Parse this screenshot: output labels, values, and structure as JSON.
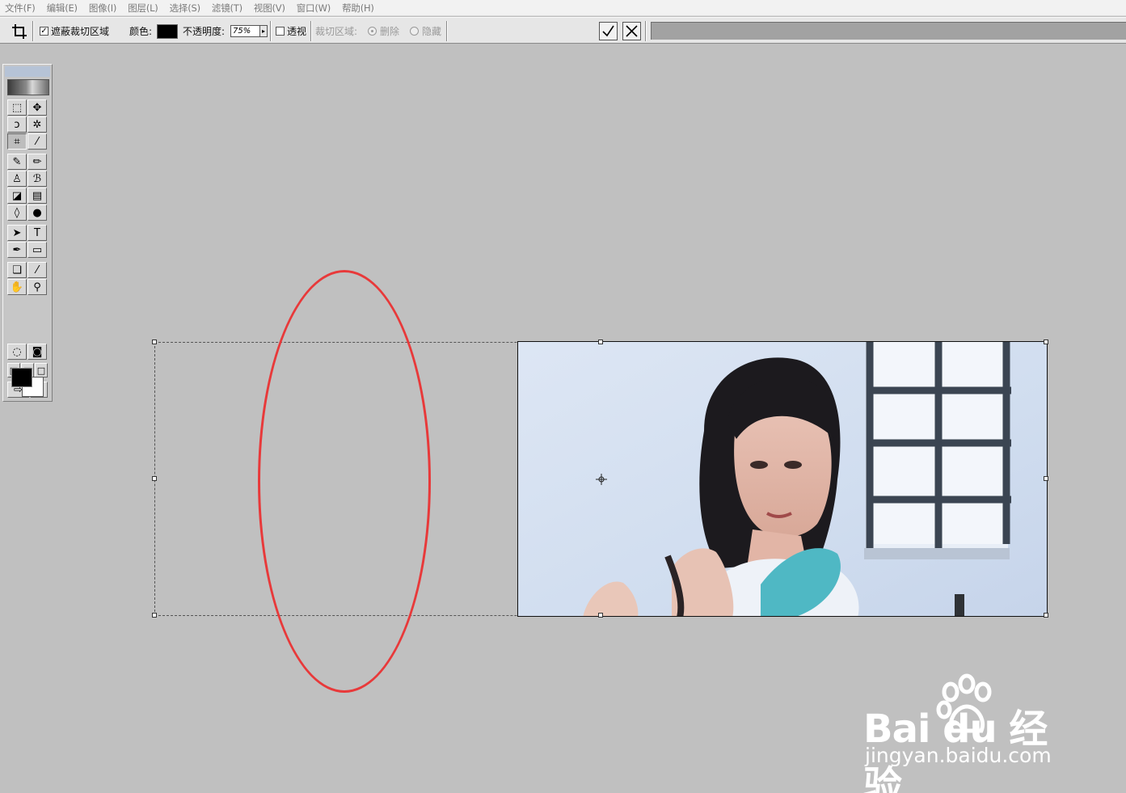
{
  "menu": [
    "文件(F)",
    "编辑(E)",
    "图像(I)",
    "图层(L)",
    "选择(S)",
    "滤镜(T)",
    "视图(V)",
    "窗口(W)",
    "帮助(H)"
  ],
  "options": {
    "shield_checkbox_label": "遮蔽裁切区域",
    "shield_checked": true,
    "color_label": "颜色:",
    "shield_color": "#000000",
    "opacity_label": "不透明度:",
    "opacity_value": "75%",
    "perspective_label": "透视",
    "perspective_checked": false,
    "crop_area_label": "裁切区域:",
    "delete_label": "删除",
    "hide_label": "隐藏",
    "delete_selected": true,
    "commit_icon": "checkmark-icon",
    "cancel_icon": "cancel-x-icon"
  },
  "toolbox": {
    "tools": [
      {
        "name": "marquee-tool",
        "glyph": "⬚"
      },
      {
        "name": "move-tool",
        "glyph": "✥"
      },
      {
        "name": "lasso-tool",
        "glyph": "ↄ"
      },
      {
        "name": "magic-wand-tool",
        "glyph": "✲"
      },
      {
        "name": "crop-tool",
        "glyph": "⌗"
      },
      {
        "name": "slice-tool",
        "glyph": "⁄"
      },
      {
        "name": "healing-brush-tool",
        "glyph": "✎"
      },
      {
        "name": "brush-tool",
        "glyph": "✏"
      },
      {
        "name": "clone-stamp-tool",
        "glyph": "♙"
      },
      {
        "name": "history-brush-tool",
        "glyph": "ℬ"
      },
      {
        "name": "eraser-tool",
        "glyph": "◪"
      },
      {
        "name": "gradient-tool",
        "glyph": "▤"
      },
      {
        "name": "blur-tool",
        "glyph": "◊"
      },
      {
        "name": "dodge-tool",
        "glyph": "●"
      },
      {
        "name": "path-selection-tool",
        "glyph": "➤"
      },
      {
        "name": "type-tool",
        "glyph": "T"
      },
      {
        "name": "pen-tool",
        "glyph": "✒"
      },
      {
        "name": "rectangle-tool",
        "glyph": "▭"
      },
      {
        "name": "notes-tool",
        "glyph": "❏"
      },
      {
        "name": "eyedropper-tool",
        "glyph": "⁄"
      },
      {
        "name": "hand-tool",
        "glyph": "✋"
      },
      {
        "name": "zoom-tool",
        "glyph": "⚲"
      },
      {
        "name": "standard-mode",
        "glyph": "◌"
      },
      {
        "name": "quick-mask-mode",
        "glyph": "◙"
      },
      {
        "name": "screen-mode-standard",
        "glyph": "▣"
      },
      {
        "name": "screen-mode-full-menu",
        "glyph": "◫"
      },
      {
        "name": "screen-mode-full",
        "glyph": "□"
      },
      {
        "name": "jump-to-imageready",
        "glyph": "⇨"
      },
      {
        "name": "imageready-icon",
        "glyph": "▦"
      }
    ],
    "foreground_color": "#000000",
    "background_color": "#ffffff"
  },
  "watermark": {
    "brand": "Bai du 经验",
    "url": "jingyan.baidu.com"
  }
}
